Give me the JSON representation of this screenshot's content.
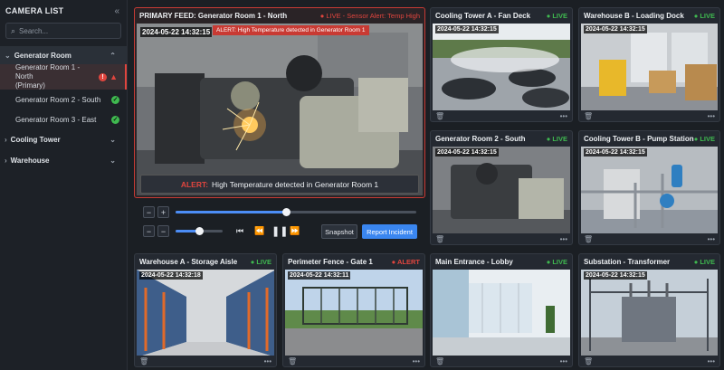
{
  "sidebar": {
    "title": "CAMERA LIST",
    "search_placeholder": "Search...",
    "groups": [
      {
        "label": "Generator Room",
        "cameras": [
          {
            "label1": "Generator Room 1 - North",
            "label2": "(Primary)"
          },
          {
            "label": "Generator Room 2 - South"
          },
          {
            "label": "Generator Room 3 - East"
          }
        ]
      },
      {
        "label": "Cooling Tower"
      },
      {
        "label": "Warehouse"
      }
    ]
  },
  "primary": {
    "title": "PRIMARY FEED: Generator Room 1 - North",
    "status": "● LIVE - Sensor Alert: Temp High",
    "timestamp": "2024-05-22 14:32:15",
    "overlay": "ALERT: High Temperature detected in Generator Room 1",
    "banner_label": "ALERT:",
    "banner_text": "High Temperature detected in Generator Room 1"
  },
  "controls": {
    "snapshot": "Snapshot",
    "report": "Report Incident",
    "progress": 0.46,
    "volume": 0.5
  },
  "tiles": [
    {
      "title": "Cooling Tower A - Fan Deck",
      "status": "● LIVE",
      "timestamp": "2024-05-22 14:32:15"
    },
    {
      "title": "Warehouse B - Loading Dock",
      "status": "● LIVE",
      "timestamp": "2024-05-22 14:32:15"
    },
    {
      "title": "Generator Room 2 - South",
      "status": "● LIVE",
      "timestamp": "2024-05-22 14:32:15"
    },
    {
      "title": "Cooling Tower B - Pump Station",
      "status": "● LIVE",
      "timestamp": "2024-05-22 14:32:15"
    },
    {
      "title": "Warehouse A - Storage Aisle",
      "status": "● LIVE",
      "timestamp": "2024-05-22 14:32:18"
    },
    {
      "title": "Perimeter Fence - Gate 1",
      "status": "● ALERT",
      "timestamp": "2024-05-22 14:32:11"
    },
    {
      "title": "Main Entrance - Lobby",
      "status": "● LIVE",
      "timestamp": ""
    },
    {
      "title": "Substation - Transformer",
      "status": "● LIVE",
      "timestamp": "2024-05-22 14:32:15"
    }
  ],
  "icons": {
    "trash": "trash-icon",
    "more": "more-icon",
    "live_color": "#3fb950",
    "alert_color": "#e0453e",
    "accent": "#3a86f0"
  }
}
